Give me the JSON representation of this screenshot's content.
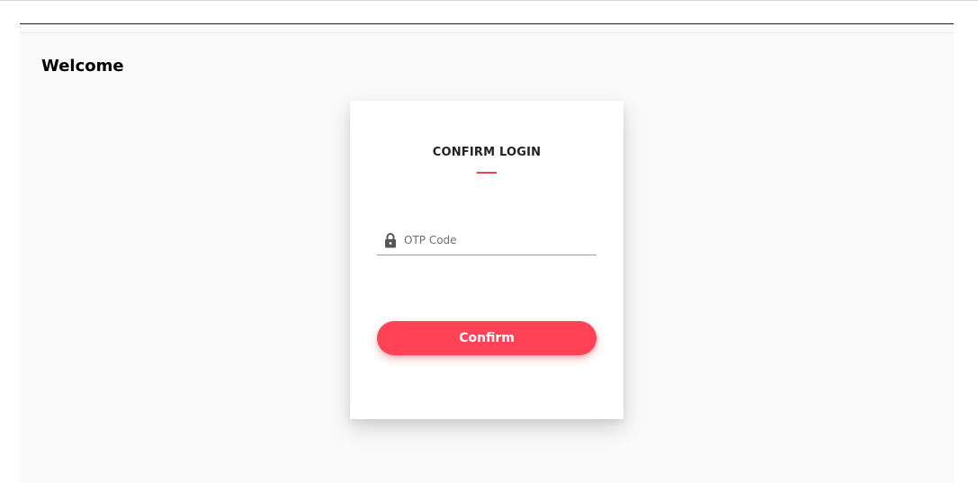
{
  "header": {
    "title": "Welcome"
  },
  "login_card": {
    "title": "CONFIRM LOGIN",
    "otp_field": {
      "placeholder": "OTP Code",
      "value": "",
      "icon": "lock-icon"
    },
    "confirm_label": "Confirm"
  },
  "colors": {
    "accent": "#ff4255",
    "background": "#fafafa",
    "card": "#ffffff"
  }
}
